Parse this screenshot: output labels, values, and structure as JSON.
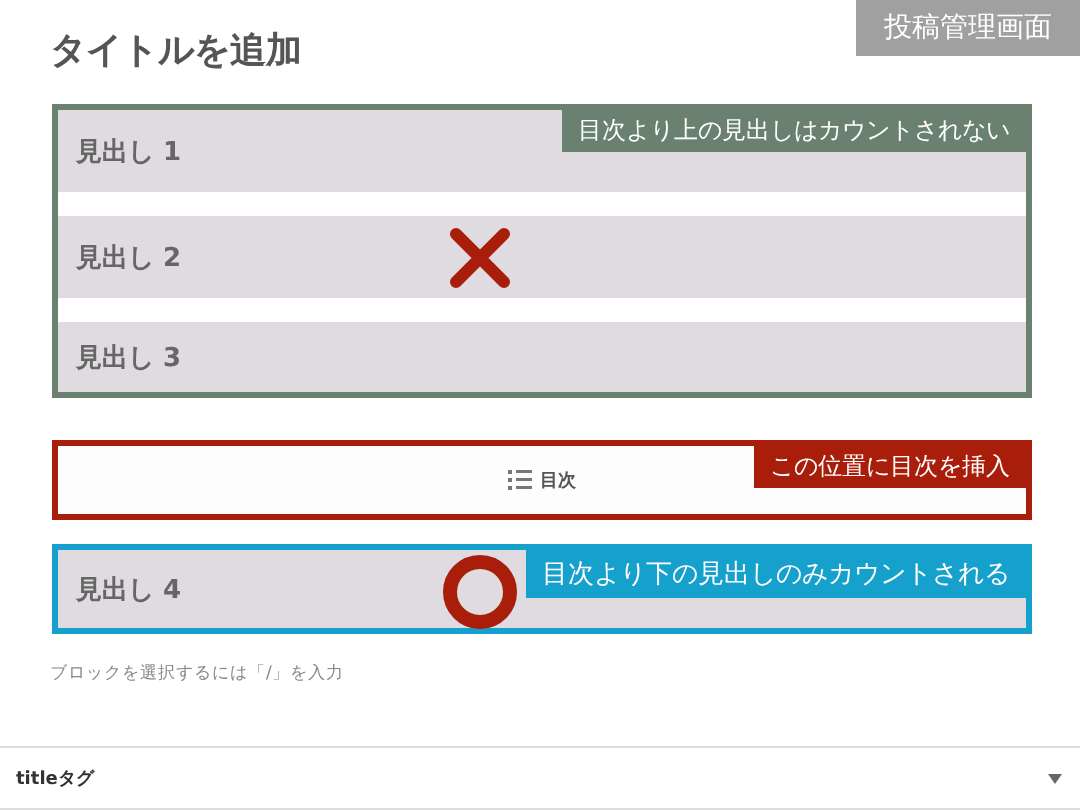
{
  "corner_label": "投稿管理画面",
  "title": "タイトルを追加",
  "sections": [
    {
      "kind": "headings",
      "color": "#6a8170",
      "note": "目次より上の見出しはカウントされない",
      "mark": {
        "kind": "cross"
      },
      "headings": [
        "見出し 1",
        "見出し 2",
        "見出し 3"
      ]
    },
    {
      "kind": "toc",
      "color": "#a81e0a",
      "note": "この位置に目次を挿入",
      "block_label": "目次"
    },
    {
      "kind": "headings",
      "color": "#16a0cc",
      "note": "目次より下の見出しのみカウントされる",
      "mark": {
        "kind": "circle"
      },
      "headings": [
        "見出し 4"
      ]
    }
  ],
  "hint": "ブロックを選択するには「/」を入力",
  "panel": {
    "label": "titleタグ",
    "expanded": false
  }
}
